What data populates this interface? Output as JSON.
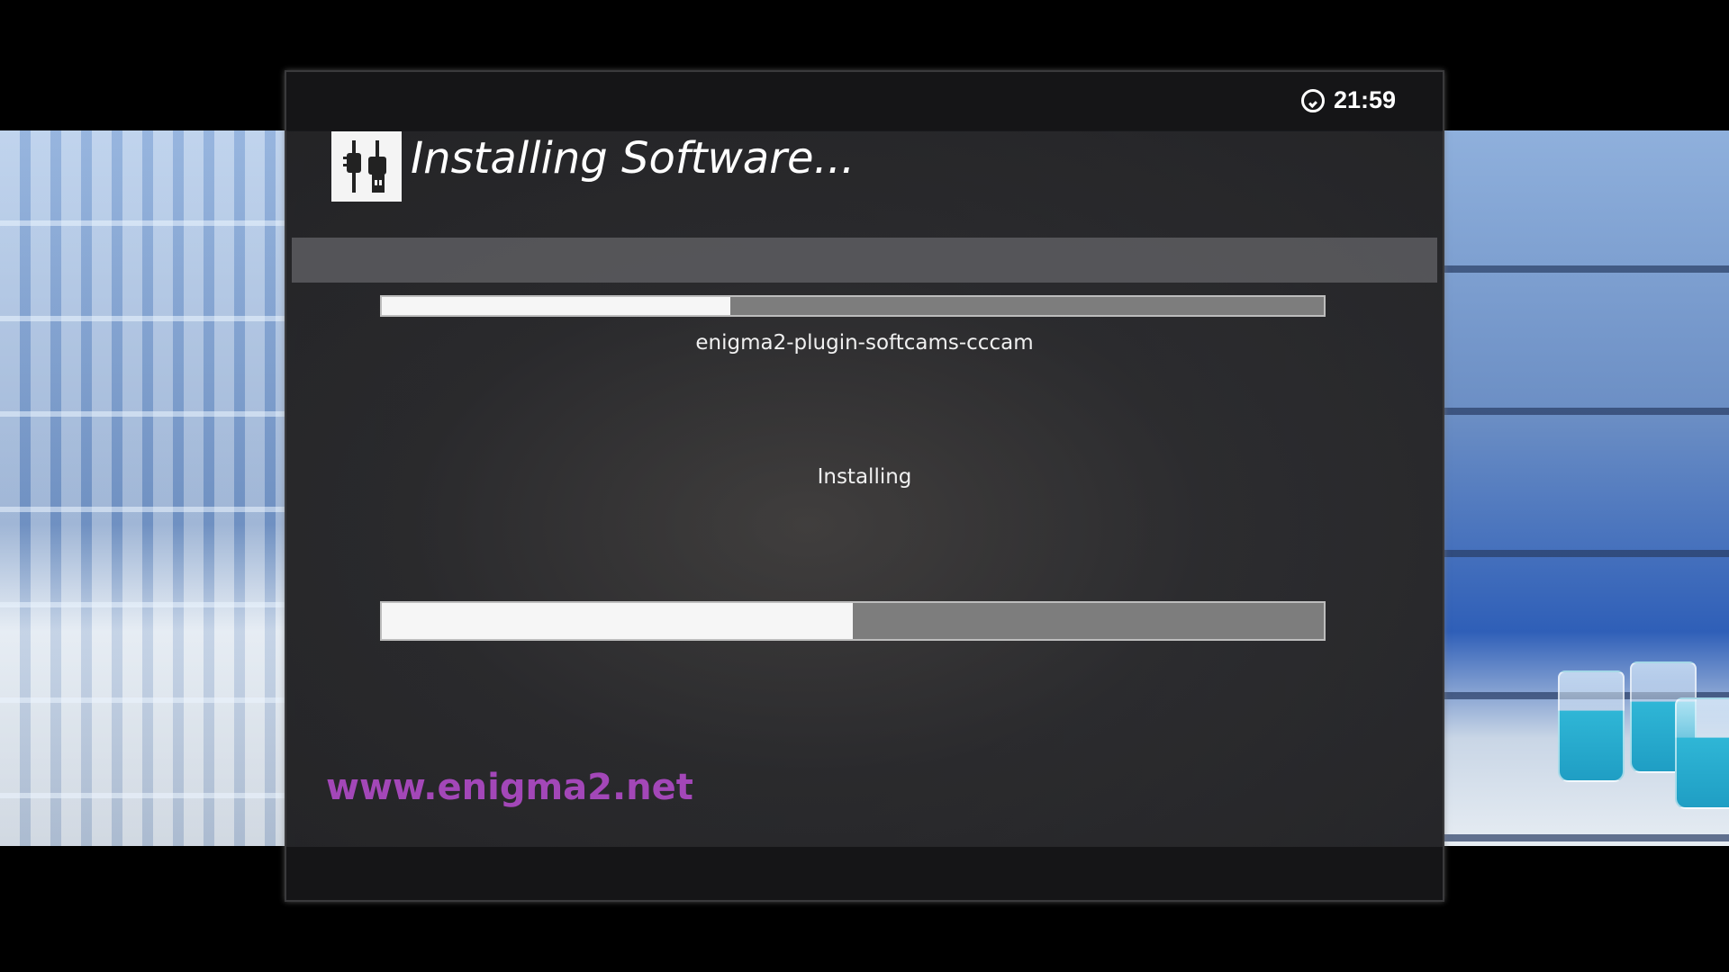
{
  "window": {
    "title": "Installing Software..."
  },
  "clock": {
    "time": "21:59",
    "icon": "clock-icon"
  },
  "title_icon": "plug-icon",
  "progress": {
    "package": {
      "name": "enigma2-plugin-softcams-cccam",
      "fraction": 0.37
    },
    "overall": {
      "fraction": 0.5
    }
  },
  "status": {
    "text": "Installing"
  },
  "watermark": {
    "text": "www.enigma2.net"
  },
  "colors": {
    "watermark": "#a347b8",
    "progress_fill": "#f6f6f6",
    "progress_track": "#7d7d7d"
  }
}
